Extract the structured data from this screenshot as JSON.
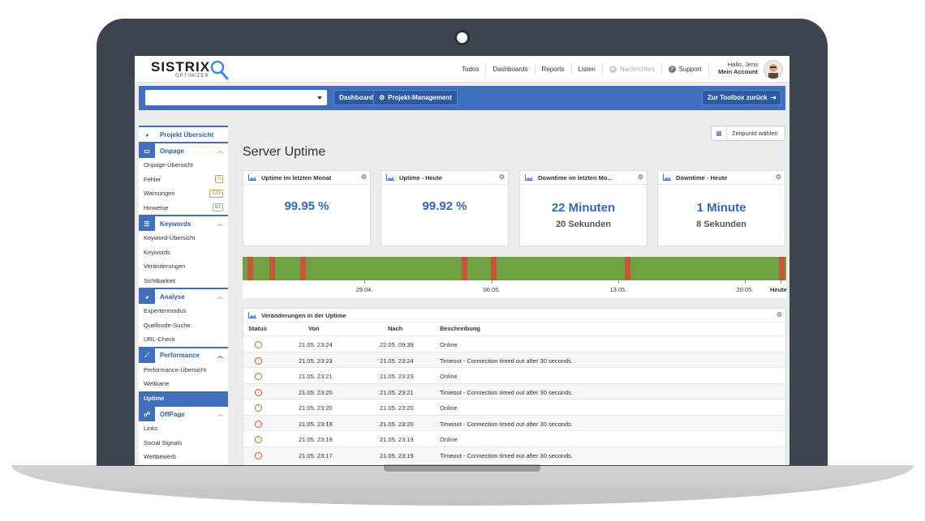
{
  "header": {
    "logo_text": "SISTRIX",
    "logo_sub": "OPTIMIZER",
    "nav": [
      {
        "label": "Todos",
        "muted": false
      },
      {
        "label": "Dashboards",
        "muted": false
      },
      {
        "label": "Reports",
        "muted": false
      },
      {
        "label": "Listen",
        "muted": false
      },
      {
        "label": "Nachrichten",
        "muted": true
      },
      {
        "label": "Support",
        "muted": false
      }
    ],
    "greeting": "Hallo, Jens",
    "account": "Mein Account"
  },
  "toolbar": {
    "project_value": "",
    "dashboard_label": "Dashboard",
    "projekt_label": "Projekt-Management",
    "back_label": "Zur Toolbox zurück"
  },
  "sidebar": {
    "overview": "Projekt Übersicht",
    "sections": [
      {
        "title": "Onpage",
        "icon": "monitor-icon",
        "items": [
          {
            "label": "Onpage-Übersicht"
          },
          {
            "label": "Fehler",
            "badge": "0"
          },
          {
            "label": "Warnungen",
            "badge": "129"
          },
          {
            "label": "Hinweise",
            "badge": "62"
          }
        ]
      },
      {
        "title": "Keywords",
        "icon": "list-icon",
        "items": [
          {
            "label": "Keyword-Übersicht"
          },
          {
            "label": "Keywords"
          },
          {
            "label": "Veränderungen"
          },
          {
            "label": "Sichtbarkeit"
          }
        ]
      },
      {
        "title": "Analyse",
        "icon": "pie-icon",
        "items": [
          {
            "label": "Expertenmodus"
          },
          {
            "label": "Quellcode-Suche"
          },
          {
            "label": "URL-Check"
          }
        ]
      },
      {
        "title": "Performance",
        "icon": "chart-icon",
        "items": [
          {
            "label": "Performance-Übersicht"
          },
          {
            "label": "Weltkarte"
          },
          {
            "label": "Uptime",
            "active": true
          }
        ]
      },
      {
        "title": "OffPage",
        "icon": "link-icon",
        "items": [
          {
            "label": "Links"
          },
          {
            "label": "Social Signals"
          },
          {
            "label": "Wettbewerb"
          }
        ]
      }
    ]
  },
  "main": {
    "zeit_label": "Zeitpunkt wählen",
    "title": "Server Uptime",
    "cards": [
      {
        "title": "Uptime im letzten Monat",
        "value": "99.95 %",
        "sub": ""
      },
      {
        "title": "Uptime - Heute",
        "value": "99.92 %",
        "sub": ""
      },
      {
        "title": "Downtime im letzten Mo...",
        "value": "22 Minuten",
        "sub": "20 Sekunden"
      },
      {
        "title": "Downtime - Heute",
        "value": "1 Minute",
        "sub": "8 Sekunden"
      }
    ],
    "timeline": {
      "labels": [
        "29.04.",
        "06.05.",
        "13.05.",
        "20.05.",
        "Heute"
      ],
      "outage_count": 8
    },
    "changes": {
      "title": "Veränderungen in der Uptime",
      "columns": [
        "Status",
        "Von",
        "Nach",
        "Beschreibung"
      ],
      "rows": [
        {
          "status": "up",
          "von": "21.05. 23:24",
          "nach": "22.05. 09:39",
          "desc": "Online"
        },
        {
          "status": "down",
          "von": "21.05. 23:23",
          "nach": "21.05. 23:24",
          "desc": "Timeout - Connection timed out after 30 seconds."
        },
        {
          "status": "up",
          "von": "21.05. 23:21",
          "nach": "21.05. 23:23",
          "desc": "Online"
        },
        {
          "status": "down",
          "von": "21.05. 23:20",
          "nach": "21.05. 23:21",
          "desc": "Timeout - Connection timed out after 30 seconds."
        },
        {
          "status": "up",
          "von": "21.05. 23:20",
          "nach": "21.05. 23:20",
          "desc": "Online"
        },
        {
          "status": "down",
          "von": "21.05. 23:19",
          "nach": "21.05. 23:20",
          "desc": "Timeout - Connection timed out after 30 seconds."
        },
        {
          "status": "up",
          "von": "21.05. 23:19",
          "nach": "21.05. 23:19",
          "desc": "Online"
        },
        {
          "status": "down",
          "von": "21.05. 23:17",
          "nach": "21.05. 23:19",
          "desc": "Timeout - Connection timed out after 30 seconds."
        }
      ]
    }
  },
  "colors": {
    "accent": "#3f6fbd",
    "up": "#6ea241",
    "down": "#c6543a"
  }
}
